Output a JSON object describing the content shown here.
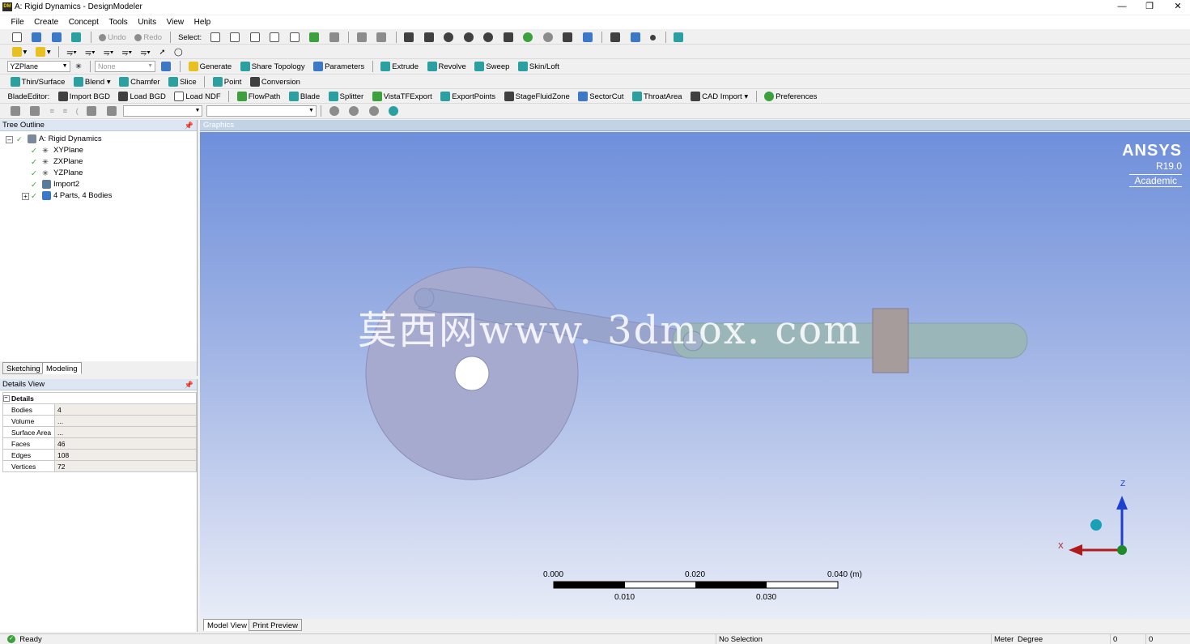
{
  "window": {
    "title": "A: Rigid Dynamics - DesignModeler",
    "app_icon": "DM"
  },
  "menu": [
    "File",
    "Create",
    "Concept",
    "Tools",
    "Units",
    "View",
    "Help"
  ],
  "toolbar1": {
    "undo": "Undo",
    "redo": "Redo",
    "select": "Select:"
  },
  "toolbar3": {
    "plane": "YZPlane",
    "sketch": "None",
    "buttons": [
      "Generate",
      "Share Topology",
      "Parameters",
      "Extrude",
      "Revolve",
      "Sweep",
      "Skin/Loft"
    ]
  },
  "toolbar4": {
    "buttons": [
      "Thin/Surface",
      "Blend",
      "Chamfer",
      "Slice",
      "Point",
      "Conversion"
    ]
  },
  "toolbar5": {
    "label": "BladeEditor:",
    "buttons": [
      "Import BGD",
      "Load BGD",
      "Load NDF",
      "FlowPath",
      "Blade",
      "Splitter",
      "VistaTFExport",
      "ExportPoints",
      "StageFluidZone",
      "SectorCut",
      "ThroatArea",
      "CAD Import",
      "Preferences"
    ]
  },
  "tree": {
    "header": "Tree Outline",
    "root": "A: Rigid Dynamics",
    "children": [
      "XYPlane",
      "ZXPlane",
      "YZPlane",
      "Import2",
      "4 Parts, 4 Bodies"
    ]
  },
  "left_tabs": [
    "Sketching",
    "Modeling"
  ],
  "details": {
    "header": "Details View",
    "group": "Details",
    "rows": [
      {
        "key": "Bodies",
        "value": "4"
      },
      {
        "key": "Volume",
        "value": "..."
      },
      {
        "key": "Surface Area",
        "value": "..."
      },
      {
        "key": "Faces",
        "value": "46"
      },
      {
        "key": "Edges",
        "value": "108"
      },
      {
        "key": "Vertices",
        "value": "72"
      }
    ]
  },
  "graphics": {
    "header": "Graphics",
    "logo": {
      "brand": "ANSYS",
      "version": "R19.0",
      "edition": "Academic"
    },
    "watermark": "莫西网www. 3dmox. com",
    "scale": {
      "top_labels": [
        "0.000",
        "0.020",
        "0.040 (m)"
      ],
      "bottom_labels": [
        "0.010",
        "0.030"
      ]
    },
    "axes": {
      "x": "X",
      "z": "Z"
    },
    "tabs": [
      "Model View",
      "Print Preview"
    ]
  },
  "status": {
    "ready": "Ready",
    "selection": "No Selection",
    "units": "Meter",
    "angle": "Degree",
    "v1": "0",
    "v2": "0"
  }
}
